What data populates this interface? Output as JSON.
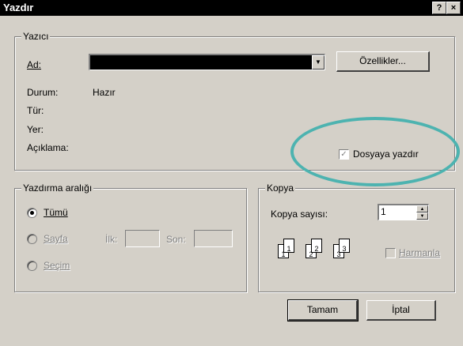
{
  "window": {
    "title": "Yazdır",
    "help_btn": "?",
    "close_btn": "×"
  },
  "printer": {
    "legend": "Yazıcı",
    "name_label": "Ad:",
    "properties_btn": "Özellikler...",
    "status_label": "Durum:",
    "status_value": "Hazır",
    "type_label": "Tür:",
    "where_label": "Yer:",
    "comment_label": "Açıklama:",
    "print_to_file_label": "Dosyaya yazdır",
    "print_to_file_checked": true
  },
  "range": {
    "legend": "Yazdırma aralığı",
    "all_label": "Tümü",
    "pages_label": "Sayfa",
    "from_label": "İlk:",
    "to_label": "Son:",
    "selection_label": "Seçim",
    "selected": "all"
  },
  "copies": {
    "legend": "Kopya",
    "count_label": "Kopya sayısı:",
    "count_value": "1",
    "collate_label": "Harmanla",
    "collate_checked": false,
    "page_digits": [
      "1",
      "1",
      "2",
      "2",
      "3",
      "3"
    ]
  },
  "buttons": {
    "ok": "Tamam",
    "cancel": "İptal"
  },
  "colors": {
    "annotation": "#4db3b0",
    "titlebar": "#000000",
    "face": "#d4d0c8"
  }
}
